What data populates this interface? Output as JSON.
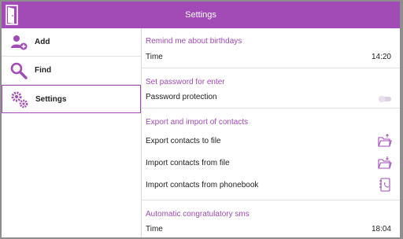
{
  "app": {
    "title": "Settings",
    "accent": "#a24bb7"
  },
  "titlebar": {
    "exit_icon": "door-exit-icon"
  },
  "sidebar": {
    "items": [
      {
        "label": "Add",
        "icon": "add-user-icon"
      },
      {
        "label": "Find",
        "icon": "magnifier-icon"
      },
      {
        "label": "Settings",
        "icon": "gears-icon",
        "selected": true
      }
    ]
  },
  "sections": {
    "birthdays": {
      "header": "Remind me about birthdays",
      "time_label": "Time",
      "time_value": "14:20"
    },
    "password": {
      "header": "Set password for enter",
      "protection_label": "Password protection",
      "protection_enabled": false
    },
    "contacts": {
      "header": "Export and import of contacts",
      "export_label": "Export contacts to file",
      "import_file_label": "Import contacts from file",
      "import_phonebook_label": "Import contacts from phonebook"
    },
    "sms": {
      "header": "Automatic congratulatory sms",
      "time_label": "Time",
      "time_value": "18:04"
    }
  }
}
